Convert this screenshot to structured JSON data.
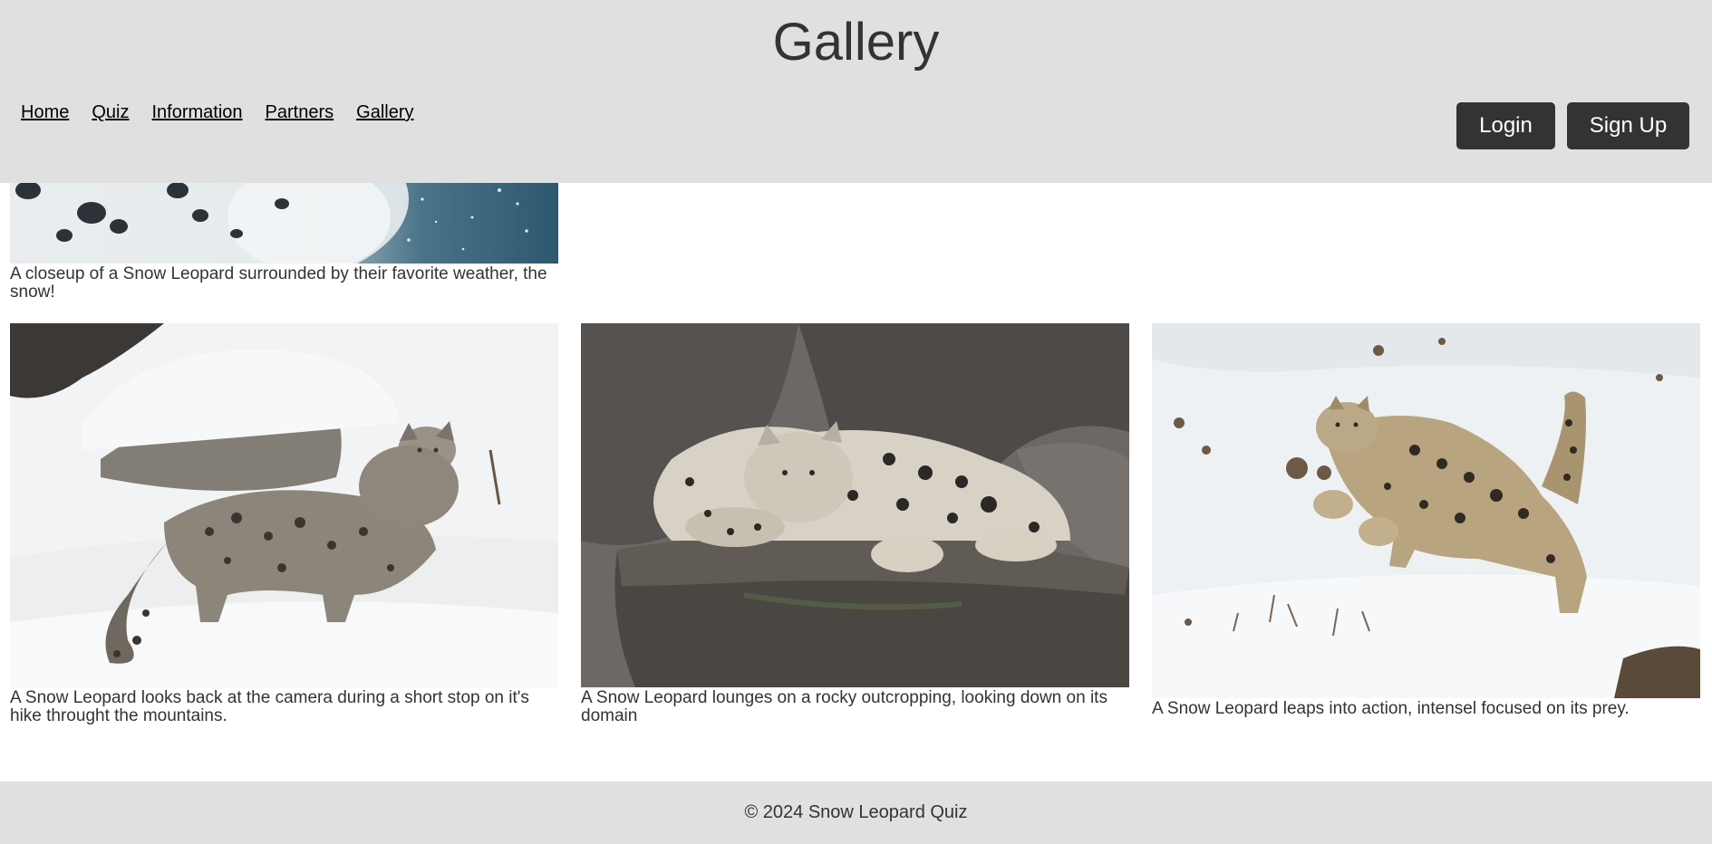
{
  "header": {
    "title": "Gallery",
    "nav": [
      {
        "label": "Home",
        "icon": ""
      },
      {
        "label": "Quiz",
        "icon": ""
      },
      {
        "label": "Information",
        "icon": ""
      },
      {
        "label": "Partners",
        "icon": ""
      },
      {
        "label": "Gallery",
        "icon": ""
      }
    ],
    "login_label": "Login",
    "signup_label": "Sign Up"
  },
  "gallery": {
    "items": [
      {
        "caption": "A closeup of a Snow Leopard surrounded by their favorite weather, the snow!",
        "image": "snow-leopard-closeup-in-snowfall"
      },
      {
        "caption": "A Snow Leopard looks back at the camera during a short stop on it's hike throught the mountains.",
        "image": "snow-leopard-looking-back-in-snow"
      },
      {
        "caption": "A Snow Leopard lounges on a rocky outcropping, looking down on its domain",
        "image": "snow-leopard-lounging-on-rock"
      },
      {
        "caption": "A Snow Leopard leaps into action, intensel focused on its prey.",
        "image": "snow-leopard-leaping-in-snow"
      }
    ]
  },
  "footer": {
    "text": "© 2024 Snow Leopard Quiz"
  },
  "colors": {
    "header_bg": "#e0e0e0",
    "button_bg": "#333333",
    "text": "#333333",
    "page_bg": "#ffffff"
  }
}
